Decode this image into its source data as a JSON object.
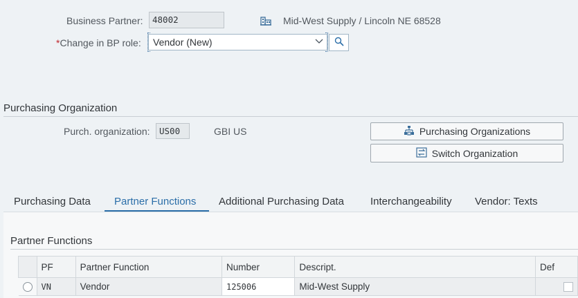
{
  "header": {
    "bp_label": "Business Partner:",
    "bp_value": "48002",
    "bp_description": "Mid-West Supply / Lincoln NE 68528",
    "role_label": "Change in BP role:",
    "role_required_mark": "*",
    "role_value": "Vendor (New)"
  },
  "purch_org_section": {
    "title": "Purchasing Organization",
    "org_label": "Purch. organization:",
    "org_value": "US00",
    "org_description": "GBI US",
    "buttons": {
      "purchasing_orgs": "Purchasing Organizations",
      "switch_org": "Switch Organization"
    }
  },
  "tabs": [
    {
      "label": "Purchasing Data",
      "active": false
    },
    {
      "label": "Partner Functions",
      "active": true
    },
    {
      "label": "Additional Purchasing Data",
      "active": false
    },
    {
      "label": "Interchangeability",
      "active": false
    },
    {
      "label": "Vendor: Texts",
      "active": false
    }
  ],
  "partner_functions": {
    "title": "Partner Functions",
    "columns": [
      "PF",
      "Partner Function",
      "Number",
      "Descript.",
      "Def"
    ],
    "rows": [
      {
        "pf": "VN",
        "function": "Vendor",
        "number": "125006",
        "description": "Mid-West Supply",
        "def": ""
      }
    ]
  },
  "colors": {
    "accent": "#2b6ea8",
    "background": "#eef2f5",
    "required": "#c0272d"
  },
  "icons": {
    "bp": "building-icon",
    "dropdown": "chevron-down-icon",
    "search": "search-icon",
    "purch_orgs": "org-structure-icon",
    "switch": "switch-icon"
  }
}
